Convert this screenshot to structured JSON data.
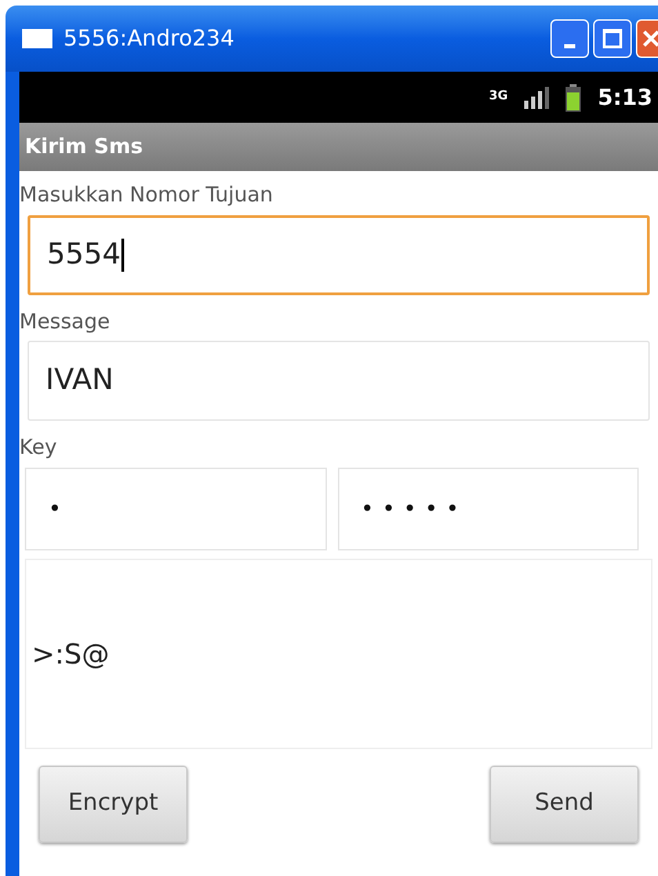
{
  "window": {
    "title": "5556:Andro234"
  },
  "status_bar": {
    "network": "3G",
    "time": "5:13"
  },
  "app_title": "Kirim Sms",
  "fields": [
    {
      "kind": "label",
      "text": "Masukkan Nomor Tujuan"
    },
    {
      "kind": "text",
      "value": "5554",
      "focused": true
    },
    {
      "kind": "label",
      "text": "Message"
    },
    {
      "kind": "text",
      "value": "IVAN",
      "focused": false
    },
    {
      "kind": "label",
      "text": "Key"
    },
    {
      "kind": "pair",
      "values": [
        "•",
        "•••••"
      ]
    },
    {
      "kind": "area",
      "value": ">:S@",
      "focused": false
    }
  ],
  "buttons": [
    "Encrypt",
    "Send"
  ]
}
